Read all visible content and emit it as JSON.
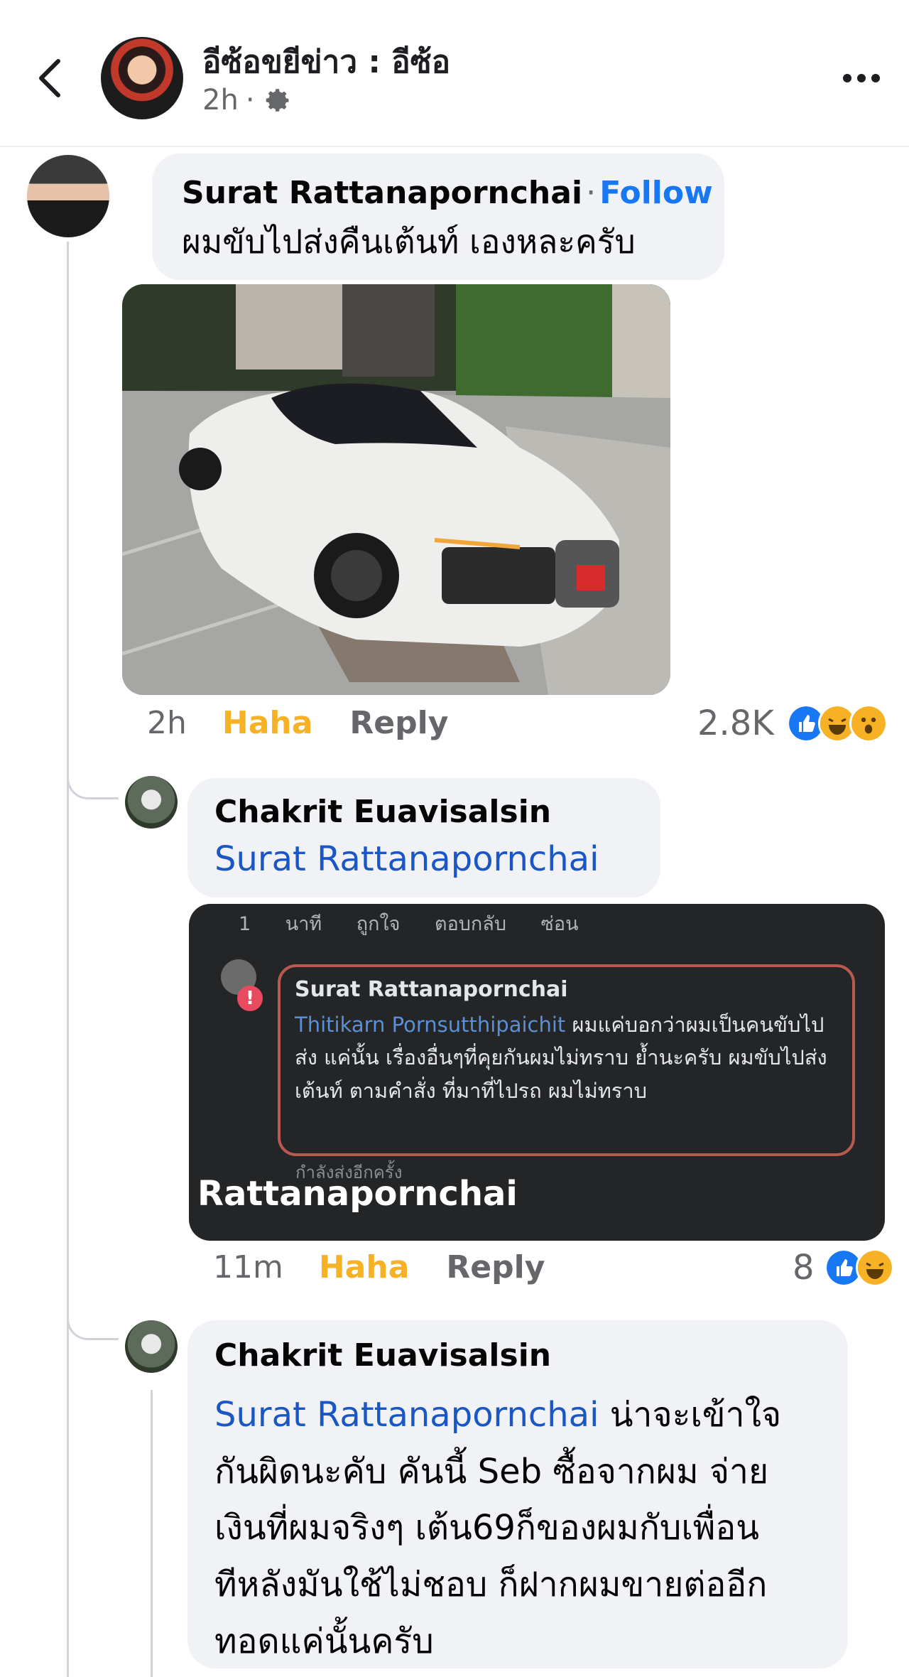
{
  "header": {
    "title": "อีซ้อขยีข่าว : อีซ้อ",
    "time": "2h",
    "separator": "·"
  },
  "comments": [
    {
      "author": "Surat Rattanapornchai",
      "follow_separator": "·",
      "follow_label": "Follow",
      "text": "ผมขับไปส่งคืนเต้นท์ เองหละครับ",
      "time": "2h",
      "haha_label": "Haha",
      "reply_label": "Reply",
      "reaction_count": "2.8K"
    },
    {
      "author": "Chakrit Euavisalsin",
      "mention": "Surat Rattanapornchai",
      "time": "11m",
      "haha_label": "Haha",
      "reply_label": "Reply",
      "reaction_count": "8",
      "screenshot": {
        "top_bar": "1 นาที ถูกใจ ตอบกลับ ซ่อน",
        "name": "Surat Rattanapornchai",
        "mention": "Thitikarn Pornsutthipaichit",
        "text": "ผมแค่บอกว่าผมเป็นคนขับไปส่ง แค่นั้น เรื่องอื่นๆที่คุยกันผมไม่ทราบ ย้ำนะครับ ผมขับไปส่งเต้นท์ ตามคำสั่ง ที่มาที่ไปรถ ผมไม่ทราบ",
        "sending": "กำลังส่งอีกครั้ง",
        "caption": "Rattanapornchai"
      }
    },
    {
      "author": "Chakrit Euavisalsin",
      "mention": "Surat Rattanapornchai",
      "text": "น่าจะเข้าใจกันผิดนะคับ คันนี้ Seb ซื้อจากผม จ่ายเงินที่ผมจริงๆ เต้น69ก็ของผมกับเพื่อนทีหลังมันใช้ไม่ชอบ ก็ฝากผมขายต่ออีกทอดแค่นั้นครับ"
    }
  ],
  "icons": {
    "back": "chevron-left-icon",
    "settings": "gear-icon",
    "more": "more-options-icon",
    "like": "like-reaction-icon",
    "haha": "haha-reaction-icon",
    "wow": "wow-reaction-icon"
  },
  "colors": {
    "link": "#1877f2",
    "mention": "#1a56c4",
    "haha": "#f7b125",
    "bubble": "#f0f2f5"
  }
}
